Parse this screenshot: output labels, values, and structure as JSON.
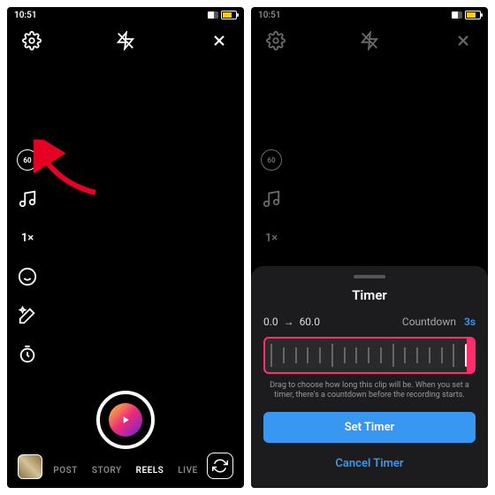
{
  "status": {
    "time": "10:51"
  },
  "left": {
    "duration_badge": "60",
    "speed_label": "1×",
    "capture_modes": [
      "POST",
      "STORY",
      "REELS",
      "LIVE"
    ],
    "active_mode_index": 2
  },
  "right": {
    "duration_badge": "60",
    "speed_label": "1×"
  },
  "timer_sheet": {
    "title": "Timer",
    "from": "0.0",
    "arrow": "→",
    "to": "60.0",
    "countdown_label": "Countdown",
    "countdown_value": "3s",
    "hint": "Drag to choose how long this clip will be. When you set a timer, there's a countdown before the recording starts.",
    "primary": "Set Timer",
    "cancel": "Cancel Timer"
  }
}
